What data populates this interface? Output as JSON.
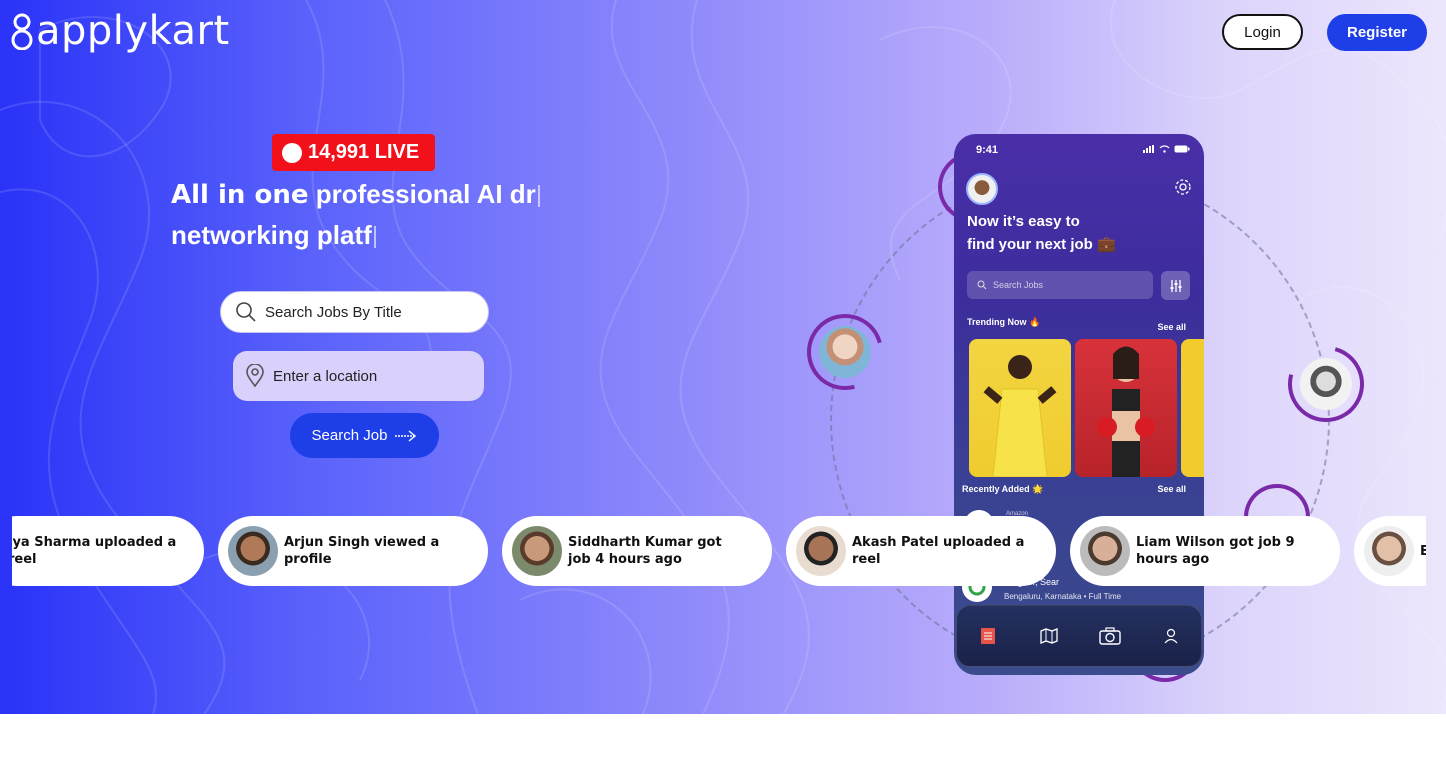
{
  "header": {
    "logo_text": "applykart",
    "login_label": "Login",
    "register_label": "Register"
  },
  "hero": {
    "live_count": "14,991 LIVE",
    "headline_line1_a": "All in one",
    "headline_line1_b": "professional  AI dr",
    "headline_line2": "networking  platf",
    "search_placeholder": "Search Jobs By Title",
    "location_placeholder": "Enter a location",
    "search_button": "Search Job"
  },
  "phone": {
    "time": "9:41",
    "title_line1": "Now it’s easy to",
    "title_line2": "find your next job 💼",
    "search_placeholder": "Search Jobs",
    "trending_label": "Trending Now 🔥",
    "see_all_1": "See all",
    "recent_label": "Recently Added 🌟",
    "see_all_2": "See all",
    "company": "Amazon",
    "role": "esigner, Sear",
    "location": "Bengaluru, Karnataka • Full Time",
    "nav_icons": [
      "document-icon",
      "map-icon",
      "camera-icon",
      "profile-icon"
    ]
  },
  "activity": [
    {
      "text": "iya Sharma uploaded a reel",
      "avatar": false
    },
    {
      "text": "Arjun Singh viewed a profile",
      "avatar": true
    },
    {
      "text": "Siddharth Kumar got job 4 hours ago",
      "avatar": true
    },
    {
      "text": "Akash Patel uploaded a reel",
      "avatar": true
    },
    {
      "text": "Liam Wilson got job 9 hours ago",
      "avatar": true
    },
    {
      "text": "El",
      "avatar": true
    }
  ],
  "colors": {
    "accent": "#1e3ee8",
    "live": "#f2101a",
    "ring": "#7a2aa8"
  }
}
